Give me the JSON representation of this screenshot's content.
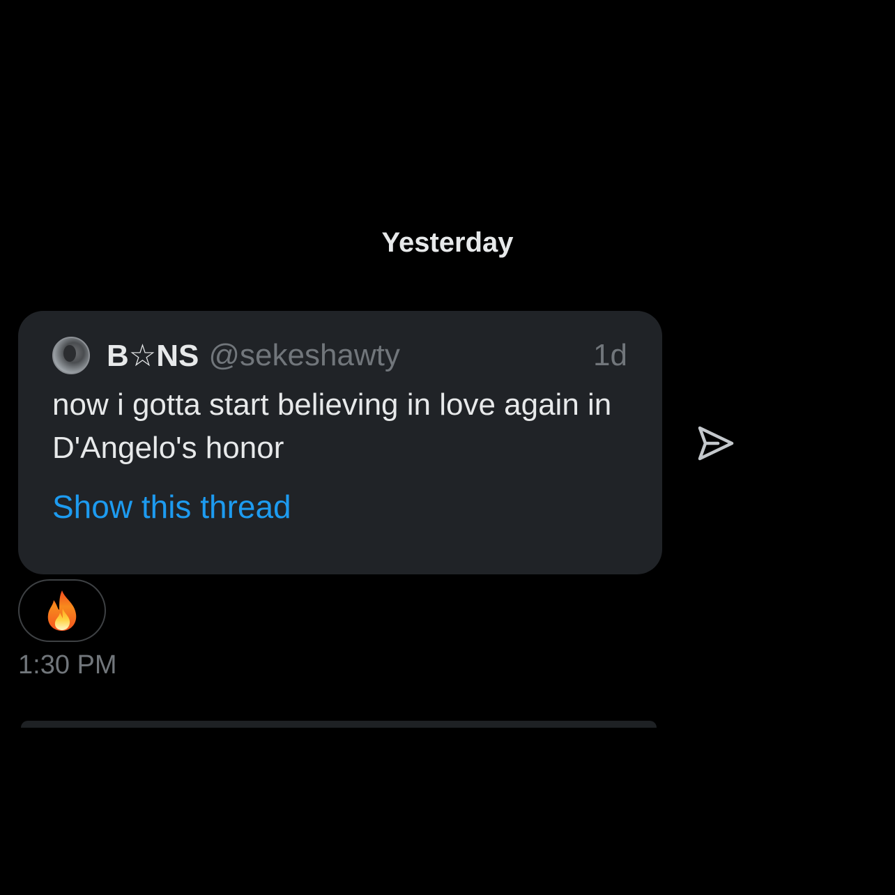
{
  "date_divider": "Yesterday",
  "tweet": {
    "display_name": "B☆NS",
    "handle": "@sekeshawty",
    "timestamp": "1d",
    "text": "now i gotta start believing in love again in D'Angelo's honor",
    "show_thread_label": "Show this thread"
  },
  "reaction": {
    "icon": "fire-emoji-icon"
  },
  "message_time": "1:30 PM",
  "share_icon": "send-icon",
  "colors": {
    "background": "#000000",
    "card": "#202327",
    "link": "#1d9bf0",
    "muted": "#71767b",
    "text": "#e7e9ea"
  }
}
